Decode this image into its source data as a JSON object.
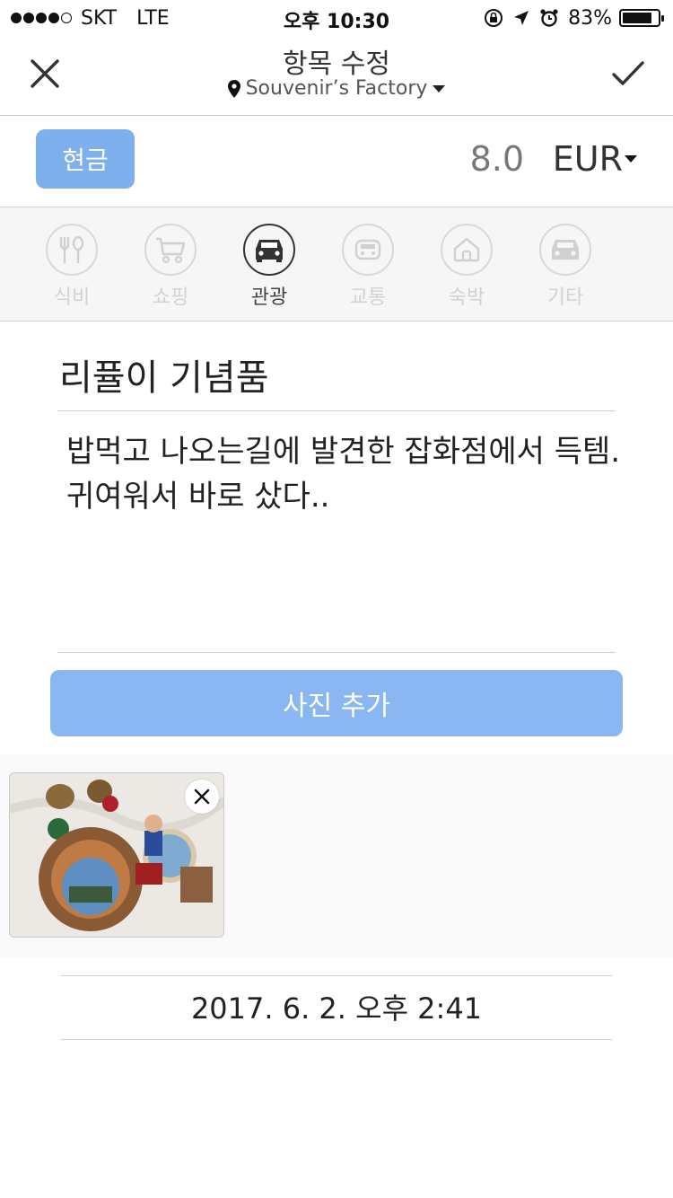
{
  "status_bar": {
    "carrier": "SKT",
    "network": "LTE",
    "time": "오후 10:30",
    "battery": "83%",
    "battery_level": 0.83
  },
  "nav": {
    "title": "항목 수정",
    "location": "Souvenir’s Factory",
    "close_icon": "close-icon",
    "confirm_icon": "checkmark-icon"
  },
  "payment": {
    "method": "현금",
    "amount": "8.0",
    "currency": "EUR",
    "accent": "#7fb0ee"
  },
  "categories": [
    {
      "label": "식비",
      "icon": "fork-spoon-icon",
      "active": false
    },
    {
      "label": "쇼핑",
      "icon": "cart-icon",
      "active": false
    },
    {
      "label": "관광",
      "icon": "car-icon",
      "active": true
    },
    {
      "label": "교통",
      "icon": "bus-icon",
      "active": false
    },
    {
      "label": "숙박",
      "icon": "house-icon",
      "active": false
    },
    {
      "label": "기타",
      "icon": "car-icon",
      "active": false
    }
  ],
  "item": {
    "title": "리퓰이 기념품",
    "memo": "밥먹고 나오는길에 발견한 잡화점에서 득템. 귀여워서 바로 샀다.."
  },
  "add_photo_label": "사진 추가",
  "date": "2017. 6. 2. 오후 2:41"
}
